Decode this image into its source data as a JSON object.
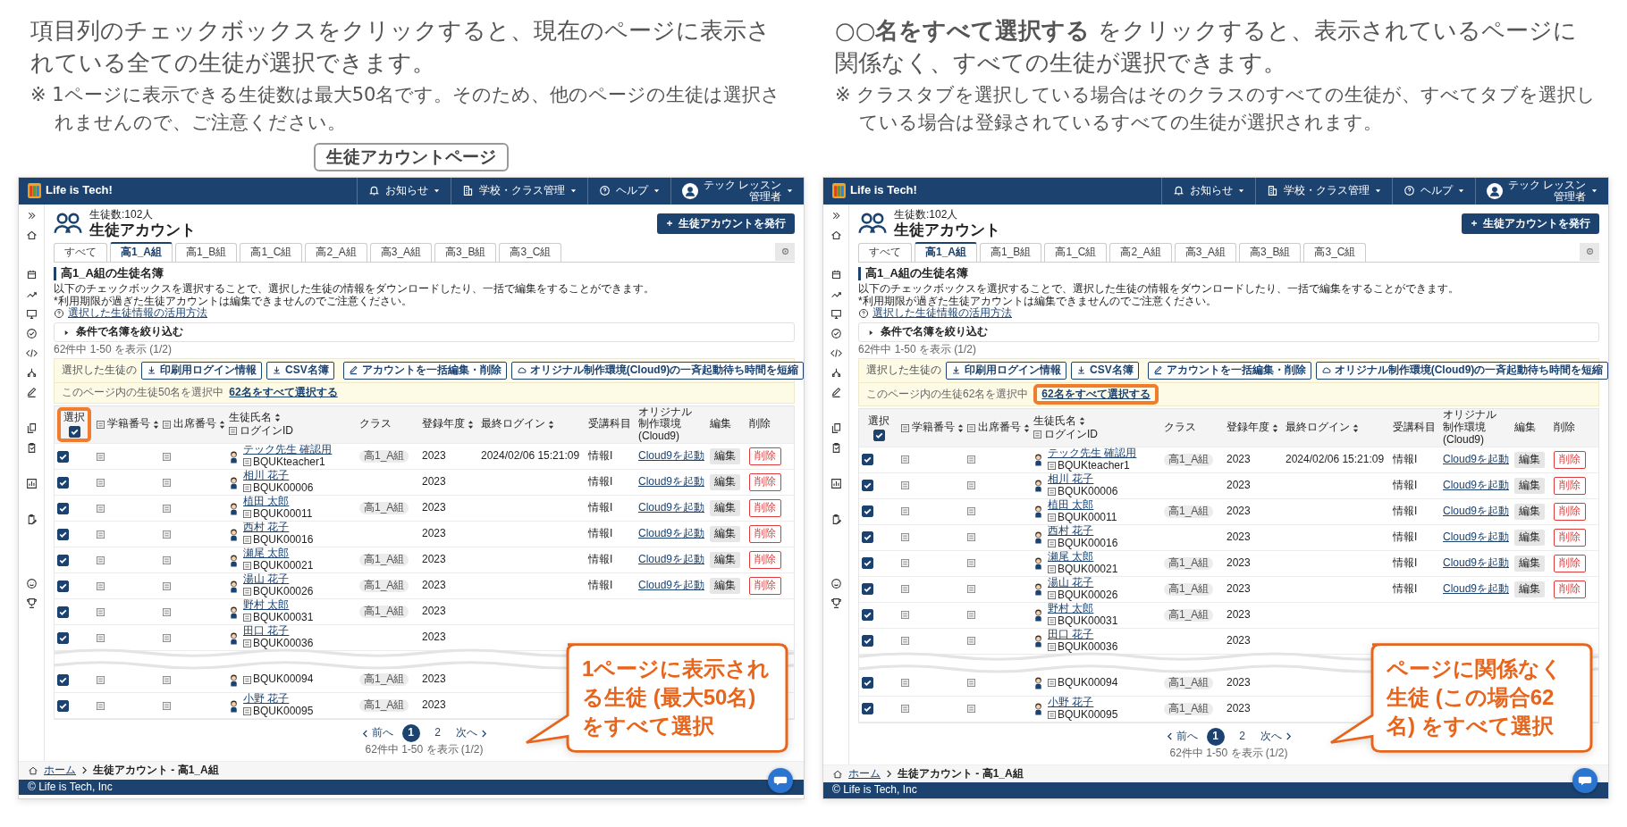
{
  "panels": [
    {
      "intro": {
        "text": "項目列のチェックボックスをクリックすると、現在のページに表示されている全ての生徒が選択できます。",
        "note": "※ 1ページに表示できる生徒数は最大50名です。そのため、他のページの生徒は選択されませんので、ご注意ください。"
      },
      "page_label": "生徒アカウントページ",
      "screen": {
        "header": {
          "logo": "Life is Tech!",
          "menus": [
            {
              "label": "お知らせ"
            },
            {
              "label": "学校・クラス管理"
            },
            {
              "label": "ヘルプ"
            }
          ],
          "user_name": "テック レッスン",
          "user_role": "管理者"
        },
        "page": {
          "count": "生徒数:102人",
          "title": "生徒アカウント",
          "issue_button": "生徒アカウントを発行"
        },
        "tabs": [
          {
            "label": "すべて",
            "selected": false
          },
          {
            "label": "高1_A組",
            "selected": true
          },
          {
            "label": "高1_B組",
            "selected": false
          },
          {
            "label": "高1_C組",
            "selected": false
          },
          {
            "label": "高2_A組",
            "selected": false
          },
          {
            "label": "高3_A組",
            "selected": false
          },
          {
            "label": "高3_B組",
            "selected": false
          },
          {
            "label": "高3_C組",
            "selected": false
          }
        ],
        "section_title": "高1_A組の生徒名簿",
        "description": [
          "以下のチェックボックスを選択することで、選択した生徒の情報をダウンロードしたり、一括で編集をすることができます。",
          "*利用期限が過ぎた生徒アカウントは編集できませんのでご注意ください。"
        ],
        "help_link": "選択した生徒情報の活用方法",
        "filter": {
          "label": "条件で名簿を絞り込む",
          "expanded": false
        },
        "result_count": "62件中 1-50 を表示 (1/2)",
        "actions": {
          "label": "選択した生徒の",
          "buttons": [
            {
              "kind": "download",
              "label": "印刷用ログイン情報"
            },
            {
              "kind": "download",
              "label": "CSV名簿"
            },
            {
              "kind": "edit",
              "label": "アカウントを一括編集・削除"
            },
            {
              "kind": "cloud",
              "label": "オリジナル制作環境(Cloud9)の一斉起動待ち時間を短縮"
            }
          ]
        },
        "selection": {
          "status": "このページ内の生徒50名を選択中",
          "select_all_link": "62名をすべて選択する",
          "highlighted": false
        },
        "table": {
          "select_header": {
            "label": "選択",
            "checked": true,
            "highlighted": true
          },
          "columns": [
            {
              "kind": "student_no",
              "label": "学籍番号",
              "sortable": true
            },
            {
              "kind": "attendance_no",
              "label": "出席番号",
              "sortable": true
            },
            {
              "kind": "name",
              "label": "生徒氏名",
              "sublabel": "ログインID",
              "sortable": true
            },
            {
              "kind": "class",
              "label": "クラス",
              "sortable": false
            },
            {
              "kind": "year",
              "label": "登録年度",
              "sortable": true
            },
            {
              "kind": "last_login",
              "label": "最終ログイン",
              "sortable": true
            },
            {
              "kind": "subject",
              "label": "受講科目",
              "sortable": false
            },
            {
              "kind": "cloud",
              "label": "オリジナル制作環境(Cloud9)",
              "sortable": false
            },
            {
              "kind": "edit",
              "label": "編集",
              "sortable": false
            },
            {
              "kind": "delete",
              "label": "削除",
              "sortable": false
            }
          ],
          "rows": [
            {
              "checked": true,
              "name": "テック先生 確認用",
              "login_id": "BQUKteacher1",
              "class": "高1_A組",
              "year": "2023",
              "last_login": "2024/02/06 15:21:09",
              "subject": "情報I",
              "cloud": "Cloud9を起動",
              "edit": "編集",
              "delete": "削除"
            },
            {
              "checked": true,
              "name": "相川 花子",
              "login_id": "BQUK00006",
              "year": "2023",
              "subject": "情報I",
              "cloud": "Cloud9を起動",
              "edit": "編集",
              "delete": "削除"
            },
            {
              "checked": true,
              "name": "植田 太郎",
              "login_id": "BQUK00011",
              "class": "高1_A組",
              "year": "2023",
              "subject": "情報I",
              "cloud": "Cloud9を起動",
              "edit": "編集",
              "delete": "削除"
            },
            {
              "checked": true,
              "name": "西村 花子",
              "login_id": "BQUK00016",
              "year": "2023",
              "subject": "情報I",
              "cloud": "Cloud9を起動",
              "edit": "編集",
              "delete": "削除"
            },
            {
              "checked": true,
              "name": "瀬尾 太郎",
              "login_id": "BQUK00021",
              "class": "高1_A組",
              "year": "2023",
              "subject": "情報I",
              "cloud": "Cloud9を起動",
              "edit": "編集",
              "delete": "削除"
            },
            {
              "checked": true,
              "name": "湯山 花子",
              "login_id": "BQUK00026",
              "class": "高1_A組",
              "year": "2023",
              "subject": "情報I",
              "cloud": "Cloud9を起動",
              "edit": "編集",
              "delete": "削除"
            },
            {
              "checked": true,
              "name": "野村 太郎",
              "login_id": "BQUK00031",
              "class": "高1_A組",
              "year": "2023"
            },
            {
              "checked": true,
              "name": "田口 花子",
              "login_id": "BQUK00036",
              "year": "2023"
            }
          ],
          "rows_after_break": [
            {
              "checked": true,
              "login_id": "BQUK00094",
              "class": "高1_A組",
              "year": "2023"
            },
            {
              "checked": true,
              "name": "小野 花子",
              "login_id": "BQUK00095",
              "class": "高1_A組",
              "year": "2023"
            }
          ]
        },
        "pagination": {
          "prev": "前へ",
          "pages": [
            {
              "label": "1",
              "selected": true
            },
            {
              "label": "2",
              "selected": false
            }
          ],
          "next": "次へ",
          "summary": "62件中 1-50 を表示 (1/2)"
        },
        "breadcrumb": {
          "home": "ホーム",
          "current": "生徒アカウント - 高1_A組"
        },
        "footer": "© Life is Tech, Inc"
      },
      "callout": "1ページに表示される生徒 (最大50名) をすべて選択"
    },
    {
      "intro": {
        "text": "○○**名をすべて選択する** をクリックすると、表示されているページに関係なく、すべての生徒が選択できます。",
        "note": "※ クラスタブを選択している場合はそのクラスのすべての生徒が、すべてタブを選択している場合は登録されているすべての生徒が選択されます。"
      },
      "screen": {
        "header": {
          "logo": "Life is Tech!",
          "menus": [
            {
              "label": "お知らせ"
            },
            {
              "label": "学校・クラス管理"
            },
            {
              "label": "ヘルプ"
            }
          ],
          "user_name": "テック レッスン",
          "user_role": "管理者"
        },
        "page": {
          "count": "生徒数:102人",
          "title": "生徒アカウント",
          "issue_button": "生徒アカウントを発行"
        },
        "tabs": [
          {
            "label": "すべて",
            "selected": false
          },
          {
            "label": "高1_A組",
            "selected": true
          },
          {
            "label": "高1_B組",
            "selected": false
          },
          {
            "label": "高1_C組",
            "selected": false
          },
          {
            "label": "高2_A組",
            "selected": false
          },
          {
            "label": "高3_A組",
            "selected": false
          },
          {
            "label": "高3_B組",
            "selected": false
          },
          {
            "label": "高3_C組",
            "selected": false
          }
        ],
        "section_title": "高1_A組の生徒名簿",
        "description": [
          "以下のチェックボックスを選択することで、選択した生徒の情報をダウンロードしたり、一括で編集をすることができます。",
          "*利用期限が過ぎた生徒アカウントは編集できませんのでご注意ください。"
        ],
        "help_link": "選択した生徒情報の活用方法",
        "filter": {
          "label": "条件で名簿を絞り込む",
          "expanded": false
        },
        "result_count": "62件中 1-50 を表示 (1/2)",
        "actions": {
          "label": "選択した生徒の",
          "buttons": [
            {
              "kind": "download",
              "label": "印刷用ログイン情報"
            },
            {
              "kind": "download",
              "label": "CSV名簿"
            },
            {
              "kind": "edit",
              "label": "アカウントを一括編集・削除"
            },
            {
              "kind": "cloud",
              "label": "オリジナル制作環境(Cloud9)の一斉起動待ち時間を短縮"
            }
          ]
        },
        "selection": {
          "status": "このページ内の生徒62名を選択中",
          "select_all_link": "62名をすべて選択する",
          "highlighted": true
        },
        "table": {
          "select_header": {
            "label": "選択",
            "checked": true,
            "highlighted": false
          },
          "columns": [
            {
              "kind": "student_no",
              "label": "学籍番号",
              "sortable": true
            },
            {
              "kind": "attendance_no",
              "label": "出席番号",
              "sortable": true
            },
            {
              "kind": "name",
              "label": "生徒氏名",
              "sublabel": "ログインID",
              "sortable": true
            },
            {
              "kind": "class",
              "label": "クラス",
              "sortable": false
            },
            {
              "kind": "year",
              "label": "登録年度",
              "sortable": true
            },
            {
              "kind": "last_login",
              "label": "最終ログイン",
              "sortable": true
            },
            {
              "kind": "subject",
              "label": "受講科目",
              "sortable": false
            },
            {
              "kind": "cloud",
              "label": "オリジナル制作環境(Cloud9)",
              "sortable": false
            },
            {
              "kind": "edit",
              "label": "編集",
              "sortable": false
            },
            {
              "kind": "delete",
              "label": "削除",
              "sortable": false
            }
          ],
          "rows": [
            {
              "checked": true,
              "name": "テック先生 確認用",
              "login_id": "BQUKteacher1",
              "class": "高1_A組",
              "year": "2023",
              "last_login": "2024/02/06 15:21:09",
              "subject": "情報I",
              "cloud": "Cloud9を起動",
              "edit": "編集",
              "delete": "削除"
            },
            {
              "checked": true,
              "name": "相川 花子",
              "login_id": "BQUK00006",
              "year": "2023",
              "subject": "情報I",
              "cloud": "Cloud9を起動",
              "edit": "編集",
              "delete": "削除"
            },
            {
              "checked": true,
              "name": "植田 太郎",
              "login_id": "BQUK00011",
              "class": "高1_A組",
              "year": "2023",
              "subject": "情報I",
              "cloud": "Cloud9を起動",
              "edit": "編集",
              "delete": "削除"
            },
            {
              "checked": true,
              "name": "西村 花子",
              "login_id": "BQUK00016",
              "year": "2023",
              "subject": "情報I",
              "cloud": "Cloud9を起動",
              "edit": "編集",
              "delete": "削除"
            },
            {
              "checked": true,
              "name": "瀬尾 太郎",
              "login_id": "BQUK00021",
              "class": "高1_A組",
              "year": "2023",
              "subject": "情報I",
              "cloud": "Cloud9を起動",
              "edit": "編集",
              "delete": "削除"
            },
            {
              "checked": true,
              "name": "湯山 花子",
              "login_id": "BQUK00026",
              "class": "高1_A組",
              "year": "2023",
              "subject": "情報I",
              "cloud": "Cloud9を起動",
              "edit": "編集",
              "delete": "削除"
            },
            {
              "checked": true,
              "name": "野村 太郎",
              "login_id": "BQUK00031",
              "class": "高1_A組",
              "year": "2023"
            },
            {
              "checked": true,
              "name": "田口 花子",
              "login_id": "BQUK00036",
              "year": "2023"
            }
          ],
          "rows_after_break": [
            {
              "checked": true,
              "login_id": "BQUK00094",
              "class": "高1_A組",
              "year": "2023"
            },
            {
              "checked": true,
              "name": "小野 花子",
              "login_id": "BQUK00095",
              "class": "高1_A組",
              "year": "2023"
            }
          ]
        },
        "pagination": {
          "prev": "前へ",
          "pages": [
            {
              "label": "1",
              "selected": true
            },
            {
              "label": "2",
              "selected": false
            }
          ],
          "next": "次へ",
          "summary": "62件中 1-50 を表示 (1/2)"
        },
        "breadcrumb": {
          "home": "ホーム",
          "current": "生徒アカウント - 高1_A組"
        },
        "footer": "© Life is Tech, Inc"
      },
      "callout": "ページに関係なく生徒 (この場合62名) をすべて選択"
    }
  ]
}
